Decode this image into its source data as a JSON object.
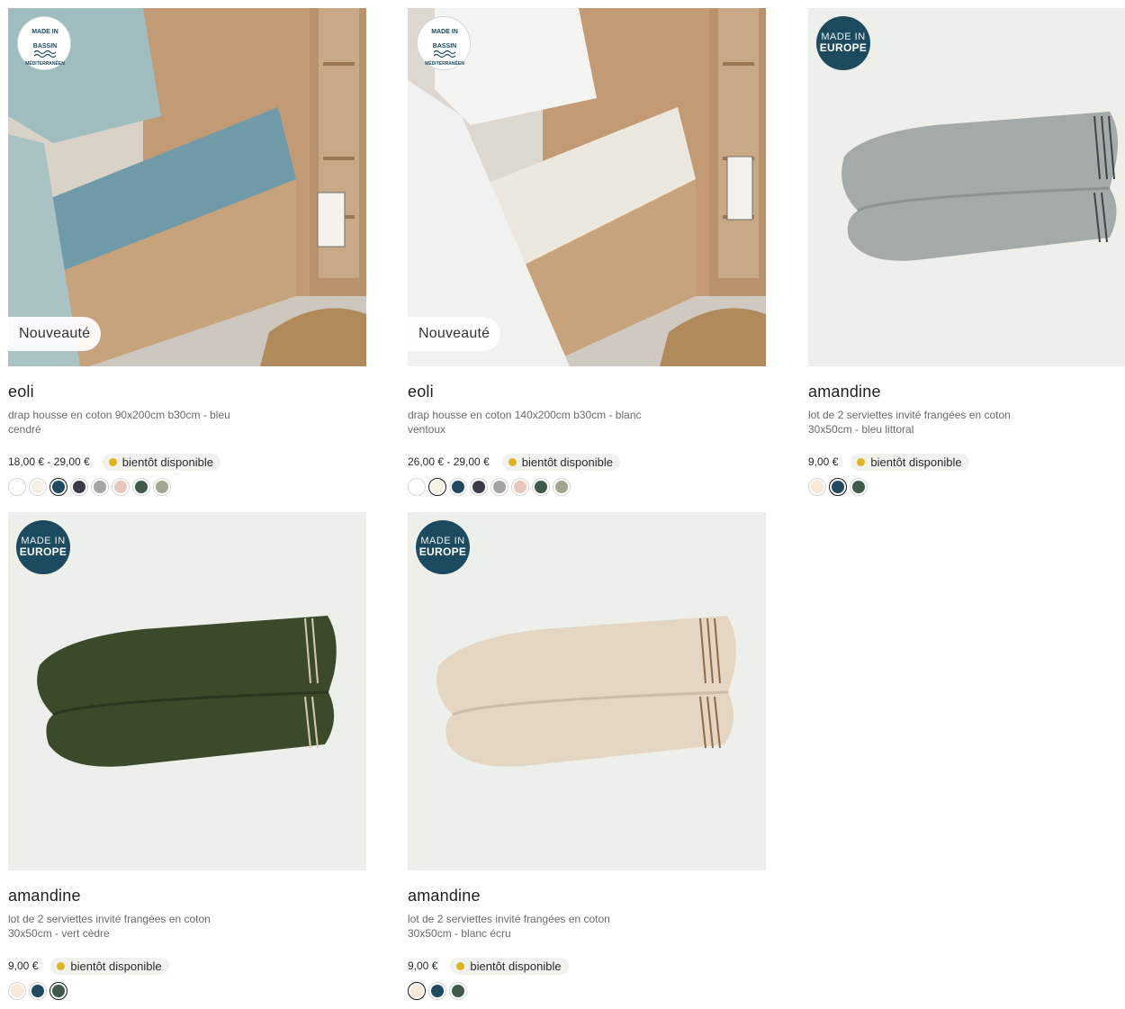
{
  "colors": {
    "badge_blue": "#1c4a5e",
    "availability_dot": "#e0b41e"
  },
  "products": [
    {
      "badge": "mediterranean",
      "badge_text": "MADE IN · BASSIN · MÉDITERRANÉEN",
      "tag": "Nouveauté",
      "name": "eoli",
      "description": "drap housse en coton 90x200cm b30cm - bleu cendré",
      "price": "18,00 € - 29,00 €",
      "availability": "bientôt disponible",
      "swatches": [
        "#ffffff",
        "#f4f1e4",
        "#1f4a60",
        "#3a3c48",
        "#a2a4a5",
        "#e7c8bb",
        "#3f5a4b",
        "#a3a58f"
      ],
      "selected_swatch": 2
    },
    {
      "badge": "mediterranean",
      "badge_text": "MADE IN · BASSIN · MÉDITERRANÉEN",
      "tag": "Nouveauté",
      "name": "eoli",
      "description": "drap housse en coton 140x200cm b30cm - blanc ventoux",
      "price": "26,00 € - 29,00 €",
      "availability": "bientôt disponible",
      "swatches": [
        "#ffffff",
        "#f4f1e4",
        "#1f4a60",
        "#3a3c48",
        "#a2a4a5",
        "#e7c8bb",
        "#3f5a4b",
        "#a3a58f"
      ],
      "selected_swatch": 1
    },
    {
      "badge": "europe",
      "badge_line1": "MADE IN",
      "badge_line2": "EUROPE",
      "tag": "",
      "name": "amandine",
      "description": "lot de 2 serviettes invité frangées en coton 30x50cm - bleu littoral",
      "price": "9,00 €",
      "availability": "bientôt disponible",
      "swatches": [
        "#f7e8d8",
        "#1f4a60",
        "#3f5a4b"
      ],
      "selected_swatch": 1
    },
    {
      "badge": "europe",
      "badge_line1": "MADE IN",
      "badge_line2": "EUROPE",
      "tag": "",
      "name": "amandine",
      "description": "lot de 2 serviettes invité frangées en coton 30x50cm - vert cèdre",
      "price": "9,00 €",
      "availability": "bientôt disponible",
      "swatches": [
        "#f7e8d8",
        "#1f4a60",
        "#3f5a4b"
      ],
      "selected_swatch": 2
    },
    {
      "badge": "europe",
      "badge_line1": "MADE IN",
      "badge_line2": "EUROPE",
      "tag": "",
      "name": "amandine",
      "description": "lot de 2 serviettes invité frangées en coton 30x50cm - blanc écru",
      "price": "9,00 €",
      "availability": "bientôt disponible",
      "swatches": [
        "#f7e8d8",
        "#1f4a60",
        "#3f5a4b"
      ],
      "selected_swatch": 0
    }
  ]
}
